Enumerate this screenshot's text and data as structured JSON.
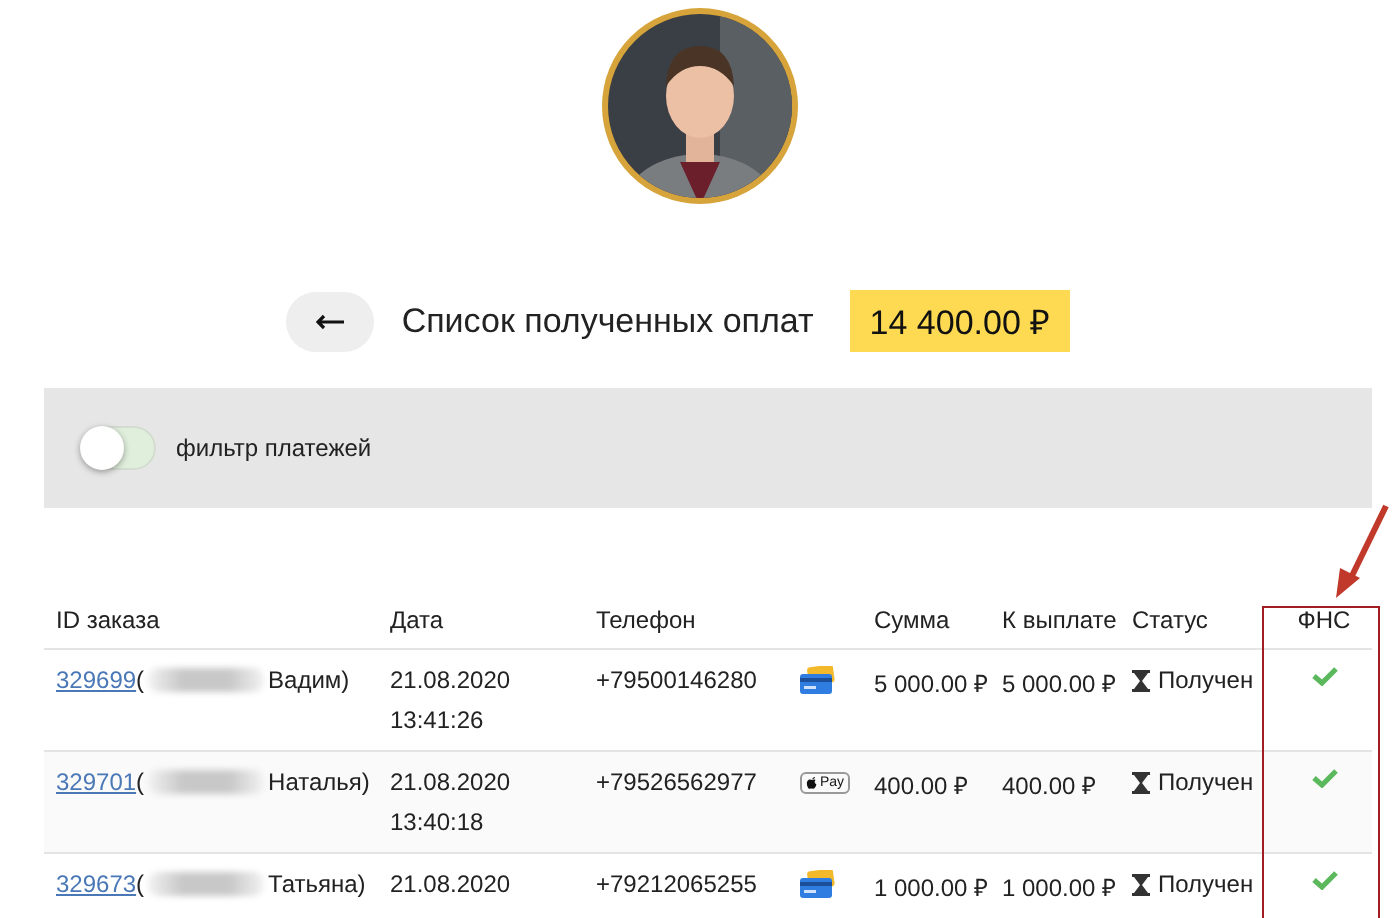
{
  "header": {
    "title": "Список полученных оплат",
    "total": "14 400.00 ₽"
  },
  "filter": {
    "label": "фильтр платежей",
    "on": false
  },
  "table": {
    "columns": [
      "ID заказа",
      "Дата",
      "Телефон",
      "Сумма",
      "К выплате",
      "Статус",
      "ФНС"
    ],
    "rows": [
      {
        "order_id": "329699",
        "open": "(",
        "customer": "Вадим)",
        "date": "21.08.2020",
        "time": "13:41:26",
        "phone": "+79500146280",
        "kind": "card",
        "amount": "5 000.00 ₽",
        "payout": "5 000.00 ₽",
        "status": "Получен",
        "fns": true
      },
      {
        "order_id": "329701",
        "open": "(",
        "customer": "Наталья)",
        "date": "21.08.2020",
        "time": "13:40:18",
        "phone": "+79526562977",
        "kind": "applepay",
        "method_label": "Pay",
        "amount": "400.00 ₽",
        "payout": "400.00 ₽",
        "status": "Получен",
        "fns": true
      },
      {
        "order_id": "329673",
        "open": "(",
        "customer": "Татьяна)",
        "date": "21.08.2020",
        "phone": "+79212065255",
        "kind": "card",
        "amount": "1 000.00 ₽",
        "payout": "1 000.00 ₽",
        "status": "Получен",
        "fns": true
      }
    ]
  },
  "annotation": {
    "kind": "highlight-box"
  }
}
